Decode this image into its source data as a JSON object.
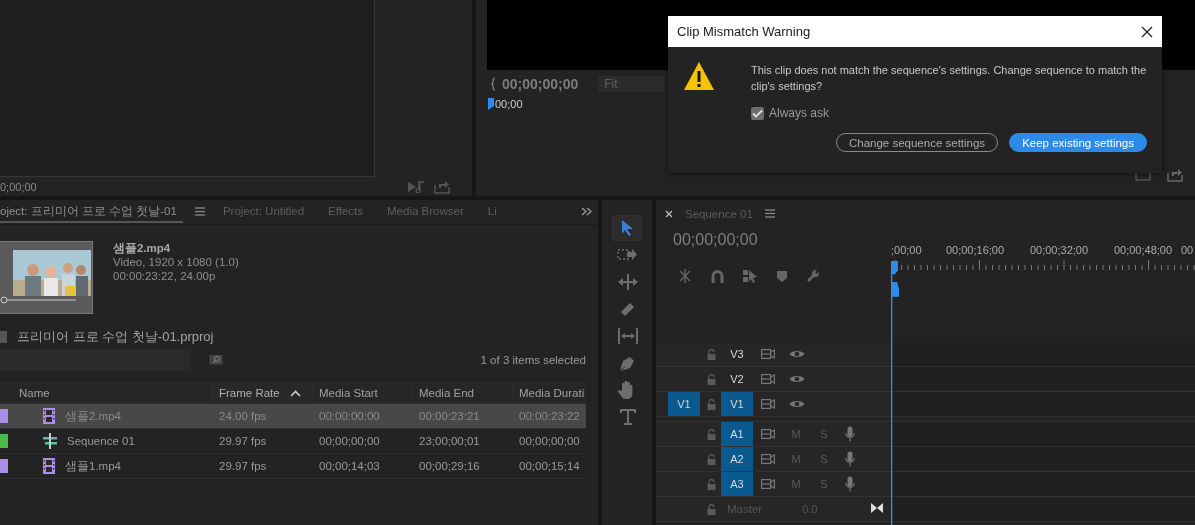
{
  "source_monitor": {
    "timecode": "0;00;00"
  },
  "program_monitor": {
    "timecode": "00;00;00;00",
    "zoom": "Fit",
    "playhead_time": "00;00"
  },
  "dialog": {
    "title": "Clip Mismatch Warning",
    "message": "This clip does not match the sequence's settings. Change sequence to match the clip's settings?",
    "always_ask": {
      "label": "Always ask",
      "checked": true
    },
    "buttons": [
      {
        "label": "Change sequence settings",
        "kind": "secondary"
      },
      {
        "label": "Keep existing settings",
        "kind": "primary"
      }
    ]
  },
  "project_panel": {
    "tabs": [
      {
        "label": "oject: 프리미어 프로 수업 첫날-01",
        "selected": true
      },
      {
        "label": "Project: Untitled",
        "selected": false
      },
      {
        "label": "Effects",
        "selected": false
      },
      {
        "label": "Media Browser",
        "selected": false
      },
      {
        "label": "Li",
        "selected": false
      }
    ],
    "preview": {
      "name": "샘플2.mp4",
      "info": "Video, 1920 x 1080 (1.0)",
      "duration": "00:00:23:22, 24.00p"
    },
    "project_file": "프리미어 프로 수업 첫날-01.prproj",
    "selection_status": "1 of 3 items selected",
    "columns": [
      {
        "label": "Name",
        "sorted": false
      },
      {
        "label": "Frame Rate",
        "sorted": true
      },
      {
        "label": "Media Start",
        "sorted": false
      },
      {
        "label": "Media End",
        "sorted": false
      },
      {
        "label": "Media Durati",
        "sorted": false
      }
    ],
    "rows": [
      {
        "kind": "clip",
        "color": "#a990e6",
        "name": "샘플2.mp4",
        "frame_rate": "24.00 fps",
        "media_start": "00:00:00:00",
        "media_end": "00:00:23:21",
        "media_duration": "00:00:23:22",
        "selected": true
      },
      {
        "kind": "sequence",
        "color": "#4cbb4c",
        "name": "Sequence 01",
        "frame_rate": "29.97 fps",
        "media_start": "00;00;00;00",
        "media_end": "23;00;00;01",
        "media_duration": "00;00;00;00",
        "selected": false
      },
      {
        "kind": "clip",
        "color": "#a990e6",
        "name": "샘플1.mp4",
        "frame_rate": "29.97 fps",
        "media_start": "00;00;14;03",
        "media_end": "00;00;29;16",
        "media_duration": "00;00;15;14",
        "selected": false
      }
    ]
  },
  "tools": [
    {
      "kind": "selection",
      "selected": true
    },
    {
      "kind": "track-select",
      "selected": false
    },
    {
      "kind": "ripple",
      "selected": false
    },
    {
      "kind": "razor",
      "selected": false
    },
    {
      "kind": "slip",
      "selected": false
    },
    {
      "kind": "pen",
      "selected": false
    },
    {
      "kind": "hand",
      "selected": false
    },
    {
      "kind": "type",
      "selected": false
    }
  ],
  "timeline": {
    "tab": "Sequence 01",
    "timecode": "00;00;00;00",
    "ruler": [
      ";00;00",
      "00;00;16;00",
      "00;00;32;00",
      "00;00;48;00",
      "00"
    ],
    "tracks": [
      {
        "kind": "video",
        "label": "V3",
        "targeted": false
      },
      {
        "kind": "video",
        "label": "V2",
        "targeted": false
      },
      {
        "kind": "video",
        "source": "V1",
        "label": "V1",
        "targeted": true
      },
      {
        "kind": "audio",
        "label": "A1",
        "targeted": true,
        "mute": "M",
        "solo": "S"
      },
      {
        "kind": "audio",
        "label": "A2",
        "targeted": true,
        "mute": "M",
        "solo": "S"
      },
      {
        "kind": "audio",
        "label": "A3",
        "targeted": true,
        "mute": "M",
        "solo": "S"
      },
      {
        "kind": "master",
        "label": "Master",
        "volume": "0.0"
      }
    ]
  }
}
